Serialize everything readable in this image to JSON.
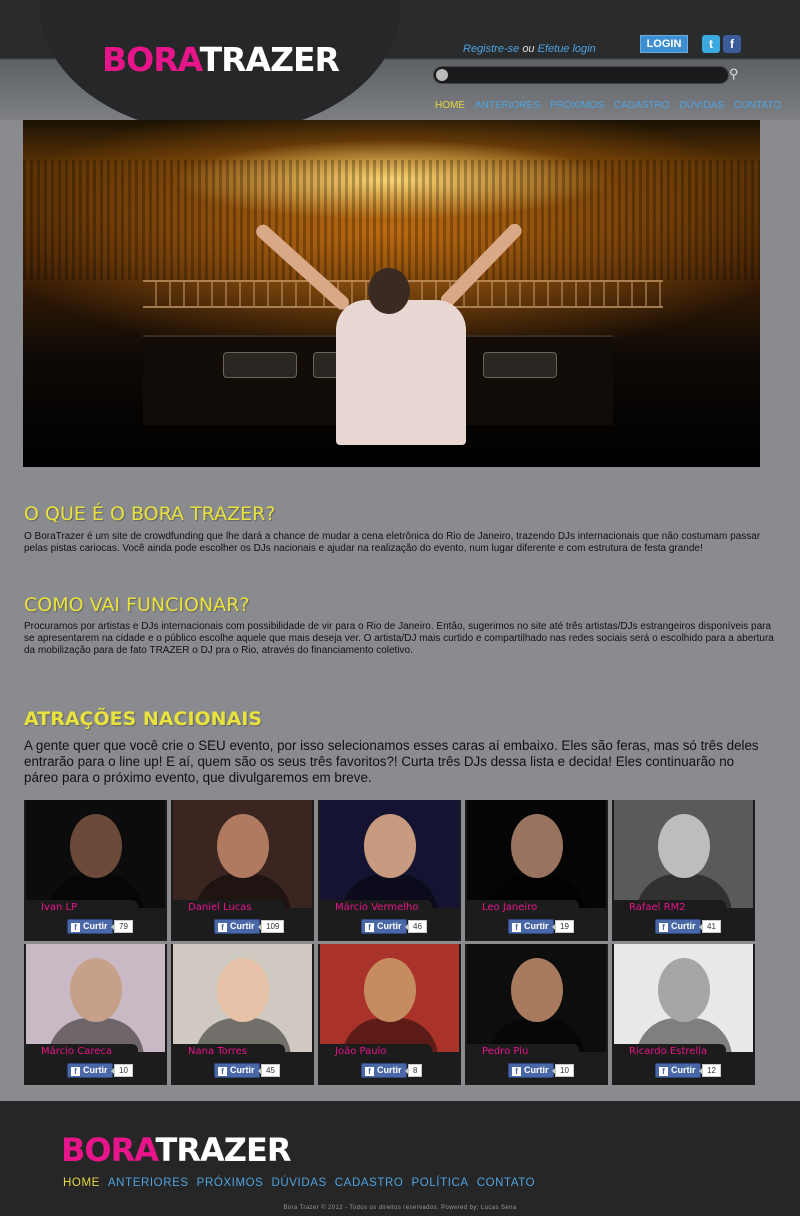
{
  "header": {
    "logo_bora": "BORA",
    "logo_trazer": "TRAZER",
    "register_link": "Registre-se",
    "or_text": "ou",
    "login_link": "Efetue login",
    "login_button": "LOGIN",
    "twitter_icon": "twitter-icon",
    "facebook_icon": "facebook-icon",
    "search_placeholder": "",
    "nav": [
      "HOME",
      "ANTERIORES",
      "PRÓXIMOS",
      "CADASTRO",
      "DÚVIDAS",
      "CONTATO"
    ],
    "nav_active": "HOME"
  },
  "sections": {
    "what_title": "O QUE É O BORA TRAZER?",
    "what_text": "O BoraTrazer é um site de crowdfunding que lhe dará a chance de mudar a cena eletrônica do Rio de Janeiro, trazendo DJs internacionais que não costumam passar pelas pistas cariocas. Você ainda pode escolher os DJs nacionais e ajudar na realização do evento, num lugar diferente e com estrutura de festa grande!",
    "how_title": "COMO VAI FUNCIONAR?",
    "how_text": "Procuramos por artistas e DJs internacionais com possibilidade de vir para o Rio de Janeiro. Então, sugerimos no site até três artistas/DJs estrangeiros disponíveis para se apresentarem na cidade e o público escolhe aquele que mais deseja ver. O artista/DJ mais curtido e compartilhado nas redes sociais será o escolhido para a abertura da mobilização para de fato TRAZER o DJ pra o Rio, através do financiamento coletivo.",
    "national_title": "ATRAÇÕES NACIONAIS",
    "national_text": "A gente quer que você crie o SEU evento, por isso selecionamos esses caras aí embaixo. Eles são feras, mas só três deles entrarão para o line up! E aí, quem são os seus três favoritos?! Curta três DJs dessa lista e decida! Eles continuarão no páreo para o próximo evento, que divulgaremos em breve."
  },
  "like_label": "Curtir",
  "djs": [
    {
      "name": "Ivan LP",
      "likes": "79",
      "bg": "#0c0c0c",
      "skin": "#6b4a3a"
    },
    {
      "name": "Daniel Lucas",
      "likes": "109",
      "bg": "#3a2520",
      "skin": "#b07a60"
    },
    {
      "name": "Márcio Vermelho",
      "likes": "46",
      "bg": "#141432",
      "skin": "#c89a80"
    },
    {
      "name": "Leo Janeiro",
      "likes": "19",
      "bg": "#050505",
      "skin": "#9a7360"
    },
    {
      "name": "Rafael RM2",
      "likes": "41",
      "bg": "#5a5a5a",
      "skin": "#bdbdbd"
    },
    {
      "name": "Márcio Careca",
      "likes": "10",
      "bg": "#c9b9c4",
      "skin": "#c7a08a"
    },
    {
      "name": "Nana Torres",
      "likes": "45",
      "bg": "#cfc9c1",
      "skin": "#e7c2a8"
    },
    {
      "name": "João Paulo",
      "likes": "8",
      "bg": "#a9332a",
      "skin": "#c58c60"
    },
    {
      "name": "Pedro Piu",
      "likes": "10",
      "bg": "#0d0d0d",
      "skin": "#a87b5e"
    },
    {
      "name": "Ricardo Estrella",
      "likes": "12",
      "bg": "#e8e8e8",
      "skin": "#a6a6a6"
    }
  ],
  "footer": {
    "logo_bora": "BORA",
    "logo_trazer": "TRAZER",
    "nav": [
      "HOME",
      "ANTERIORES",
      "PRÓXIMOS",
      "DÚVIDAS",
      "CADASTRO",
      "POLÍTICA",
      "CONTATO"
    ],
    "nav_active": "HOME",
    "copyright": "Bora Trazer © 2012 - Todos os direitos reservados. Powered by: Lucas Sena"
  },
  "colors": {
    "brand_pink": "#e8158a",
    "title_yellow": "#e8e23c",
    "link_blue": "#4fa3e0",
    "active_yellow": "#e6d740"
  }
}
